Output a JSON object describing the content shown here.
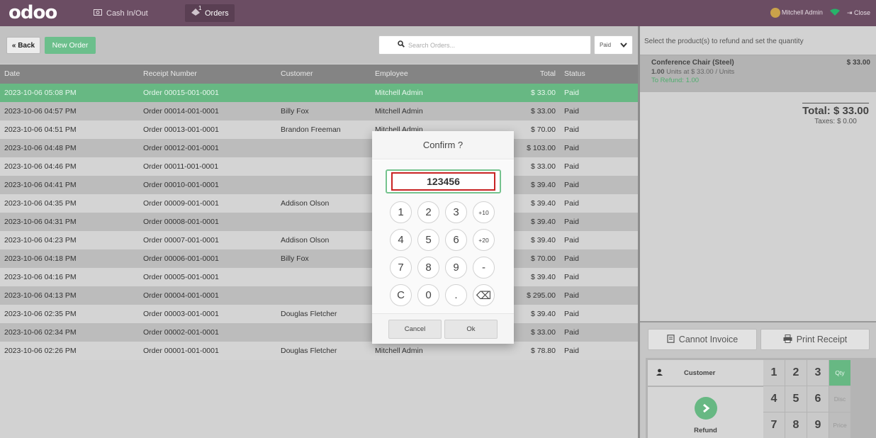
{
  "topbar": {
    "logo": "odoo",
    "nav": [
      {
        "label": "Cash In/Out",
        "icon": "cash-icon"
      },
      {
        "label": "Orders",
        "icon": "orders-icon",
        "badge": "1"
      }
    ],
    "user": "Mitchell Admin",
    "close_label": "Close"
  },
  "controls": {
    "back_label": "« Back",
    "new_order_label": "New Order",
    "search_placeholder": "Search Orders...",
    "filter_value": "Paid"
  },
  "table": {
    "headers": [
      "Date",
      "Receipt Number",
      "Customer",
      "Employee",
      "Total",
      "Status"
    ],
    "rows": [
      {
        "date": "2023-10-06 05:08 PM",
        "receipt": "Order 00015-001-0001",
        "customer": "",
        "employee": "Mitchell Admin",
        "total": "$ 33.00",
        "status": "Paid"
      },
      {
        "date": "2023-10-06 04:57 PM",
        "receipt": "Order 00014-001-0001",
        "customer": "Billy Fox",
        "employee": "Mitchell Admin",
        "total": "$ 33.00",
        "status": "Paid"
      },
      {
        "date": "2023-10-06 04:51 PM",
        "receipt": "Order 00013-001-0001",
        "customer": "Brandon Freeman",
        "employee": "Mitchell Admin",
        "total": "$ 70.00",
        "status": "Paid"
      },
      {
        "date": "2023-10-06 04:48 PM",
        "receipt": "Order 00012-001-0001",
        "customer": "",
        "employee": "",
        "total": "$ 103.00",
        "status": "Paid"
      },
      {
        "date": "2023-10-06 04:46 PM",
        "receipt": "Order 00011-001-0001",
        "customer": "",
        "employee": "",
        "total": "$ 33.00",
        "status": "Paid"
      },
      {
        "date": "2023-10-06 04:41 PM",
        "receipt": "Order 00010-001-0001",
        "customer": "",
        "employee": "",
        "total": "$ 39.40",
        "status": "Paid"
      },
      {
        "date": "2023-10-06 04:35 PM",
        "receipt": "Order 00009-001-0001",
        "customer": "Addison Olson",
        "employee": "",
        "total": "$ 39.40",
        "status": "Paid"
      },
      {
        "date": "2023-10-06 04:31 PM",
        "receipt": "Order 00008-001-0001",
        "customer": "",
        "employee": "",
        "total": "$ 39.40",
        "status": "Paid"
      },
      {
        "date": "2023-10-06 04:23 PM",
        "receipt": "Order 00007-001-0001",
        "customer": "Addison Olson",
        "employee": "",
        "total": "$ 39.40",
        "status": "Paid"
      },
      {
        "date": "2023-10-06 04:18 PM",
        "receipt": "Order 00006-001-0001",
        "customer": "Billy Fox",
        "employee": "",
        "total": "$ 70.00",
        "status": "Paid"
      },
      {
        "date": "2023-10-06 04:16 PM",
        "receipt": "Order 00005-001-0001",
        "customer": "",
        "employee": "",
        "total": "$ 39.40",
        "status": "Paid"
      },
      {
        "date": "2023-10-06 04:13 PM",
        "receipt": "Order 00004-001-0001",
        "customer": "",
        "employee": "",
        "total": "$ 295.00",
        "status": "Paid"
      },
      {
        "date": "2023-10-06 02:35 PM",
        "receipt": "Order 00003-001-0001",
        "customer": "Douglas Fletcher",
        "employee": "",
        "total": "$ 39.40",
        "status": "Paid"
      },
      {
        "date": "2023-10-06 02:34 PM",
        "receipt": "Order 00002-001-0001",
        "customer": "",
        "employee": "",
        "total": "$ 33.00",
        "status": "Paid"
      },
      {
        "date": "2023-10-06 02:26 PM",
        "receipt": "Order 00001-001-0001",
        "customer": "Douglas Fletcher",
        "employee": "Mitchell Admin",
        "total": "$ 78.80",
        "status": "Paid"
      }
    ]
  },
  "refund": {
    "hint": "Select the product(s) to refund and set the quantity",
    "line": {
      "name": "Conference Chair (Steel)",
      "price": "$ 33.00",
      "units": "1.00",
      "units_rest": "Units at $ 33.00 / Units",
      "to_refund": "To Refund: 1.00"
    },
    "total": "Total: $ 33.00",
    "taxes": "Taxes: $ 0.00",
    "invoice_label": "Cannot Invoice",
    "print_label": "Print Receipt",
    "customer_label": "Customer",
    "refund_label": "Refund",
    "numpad": [
      "1",
      "2",
      "3",
      "4",
      "5",
      "6",
      "7",
      "8",
      "9"
    ],
    "modes": [
      "Qty",
      "Disc",
      "Price"
    ]
  },
  "modal": {
    "title": "Confirm ?",
    "value": "123456",
    "keys": [
      "1",
      "2",
      "3",
      "+10",
      "4",
      "5",
      "6",
      "+20",
      "7",
      "8",
      "9",
      "-",
      "C",
      "0",
      ".",
      "⌫"
    ],
    "cancel_label": "Cancel",
    "ok_label": "Ok"
  },
  "colors": {
    "topbar": "#6b4d63",
    "accent_green": "#67b883",
    "error_red": "#c82323"
  }
}
